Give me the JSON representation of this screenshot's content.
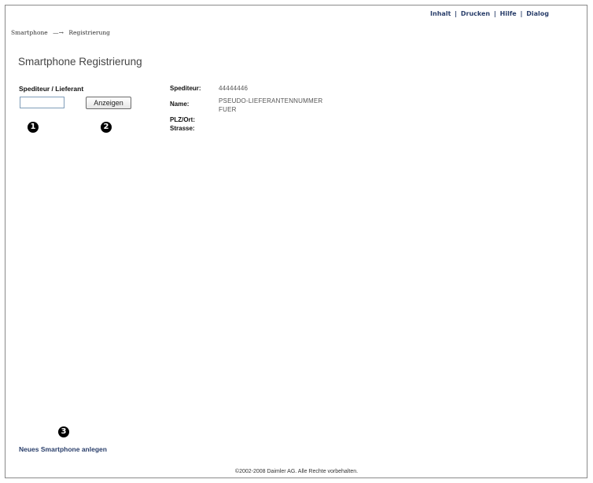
{
  "topnav": {
    "items": [
      "Inhalt",
      "Drucken",
      "Hilfe",
      "Dialog"
    ],
    "separator": "|"
  },
  "breadcrumb": {
    "items": [
      "Smartphone",
      "Registrierung"
    ],
    "arrow": "—→"
  },
  "page": {
    "title": "Smartphone Registrierung"
  },
  "form": {
    "field_label": "Spediteur / Lieferant",
    "input_value": "",
    "button_label": "Anzeigen"
  },
  "details": {
    "spediteur_label": "Spediteur:",
    "spediteur_value": "44444446",
    "name_label": "Name:",
    "name_value_line1": "PSEUDO-LIEFERANTENNUMMER",
    "name_value_line2": "FUER",
    "plz_label": "PLZ/Ort:",
    "strasse_label": "Strasse:"
  },
  "markers": {
    "one": "1",
    "two": "2",
    "three": "3"
  },
  "actions": {
    "new_smartphone": "Neues Smartphone anlegen"
  },
  "footer": {
    "copyright": "©2002-2008 Daimler AG. Alle Rechte vorbehalten."
  },
  "colors": {
    "link": "#2a3f6b",
    "border": "#8a8a8a",
    "marker": "#000000"
  }
}
